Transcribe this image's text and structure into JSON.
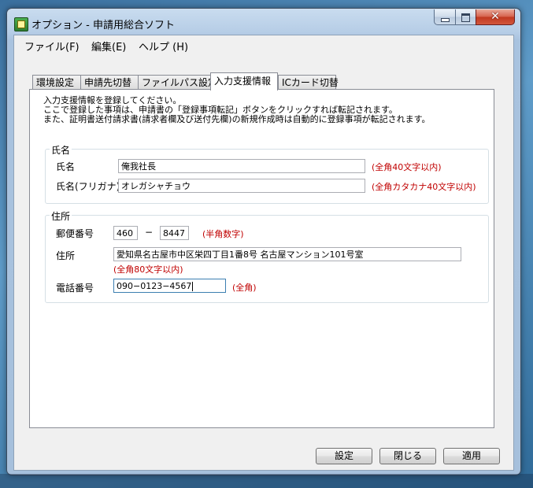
{
  "window": {
    "title": "オプション - 申請用総合ソフト",
    "close_glyph": "✕"
  },
  "menu": {
    "items": [
      {
        "label": "ファイル(F)"
      },
      {
        "label": "編集(E)"
      },
      {
        "label": "ヘルプ (H)"
      }
    ]
  },
  "tabs": [
    {
      "label": "環境設定"
    },
    {
      "label": "申請先切替"
    },
    {
      "label": "ファイルパス設定"
    },
    {
      "label": "入力支援情報"
    },
    {
      "label": "ICカード切替"
    }
  ],
  "active_tab": 3,
  "intro": {
    "line1": "入力支援情報を登録してください。",
    "line2": "ここで登録した事項は、申請書の「登録事項転記」ボタンをクリックすれば転記されます。",
    "line3": "また、証明書送付請求書(請求者欄及び送付先欄)の新規作成時は自動的に登録事項が転記されます。"
  },
  "name_group": {
    "title": "氏名",
    "name_label": "氏名",
    "name_value": "俺我社長",
    "name_note": "(全角40文字以内)",
    "kana_label": "氏名(フリガナ)",
    "kana_value": "オレガシャチョウ",
    "kana_note": "(全角カタカナ40文字以内)"
  },
  "address_group": {
    "title": "住所",
    "postal_label": "郵便番号",
    "postal1": "460",
    "postal_dash": "−",
    "postal2": "8447",
    "postal_note": "(半角数字)",
    "address_label": "住所",
    "address_value": "愛知県名古屋市中区栄四丁目1番8号  名古屋マンション101号室",
    "address_note": "(全角80文字以内)",
    "phone_label": "電話番号",
    "phone_value": "090−0123−4567",
    "phone_note": "(全角)"
  },
  "buttons": {
    "settings": "設定",
    "close": "閉じる",
    "apply": "適用"
  }
}
